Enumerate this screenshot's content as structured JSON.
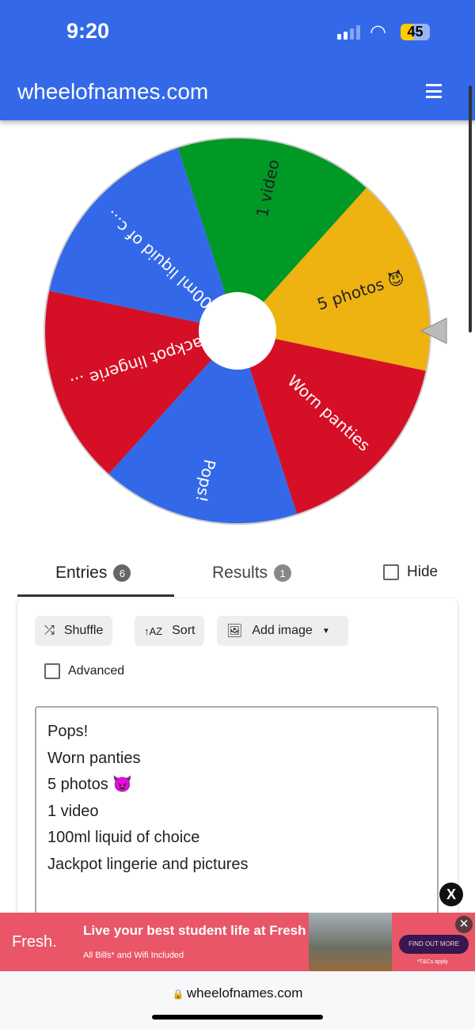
{
  "status_bar": {
    "time": "9:20",
    "battery": "45"
  },
  "header": {
    "title": "wheelofnames.com",
    "menu_icon": "hamburger-icon"
  },
  "wheel": {
    "colors": {
      "blue": "#3369e8",
      "green": "#009925",
      "yellow": "#eeb211",
      "red": "#d50f25"
    },
    "slices": [
      {
        "label": "5 photos 😈",
        "color": "#eeb211",
        "text_color": "#222"
      },
      {
        "label": "Worn panties",
        "color": "#d50f25",
        "text_color": "#fff"
      },
      {
        "label": "Pops!",
        "color": "#3369e8",
        "text_color": "#fff"
      },
      {
        "label": "Jackpot lingerie ...",
        "color": "#d50f25",
        "text_color": "#fff"
      },
      {
        "label": "100ml liquid of c...",
        "color": "#3369e8",
        "text_color": "#fff"
      },
      {
        "label": "1 video",
        "color": "#009925",
        "text_color": "#222"
      }
    ]
  },
  "tabs": {
    "entries": {
      "label": "Entries",
      "count": "6"
    },
    "results": {
      "label": "Results",
      "count": "1"
    },
    "hide_label": "Hide"
  },
  "toolbar": {
    "shuffle": "Shuffle",
    "sort": "Sort",
    "add_image": "Add image",
    "advanced": "Advanced"
  },
  "entries": [
    "Pops!",
    "Worn panties",
    "5 photos 😈",
    "1 video",
    "100ml liquid of choice",
    "Jackpot lingerie and pictures"
  ],
  "ad": {
    "brand": "Fresh.",
    "headline": "Live your best student life at Fresh",
    "sub": "All Bills* and Wifi Included",
    "cta": "FIND OUT MORE",
    "terms": "*T&Cs apply",
    "close": "✕"
  },
  "close_button": "X",
  "browser": {
    "url": "wheelofnames.com"
  }
}
